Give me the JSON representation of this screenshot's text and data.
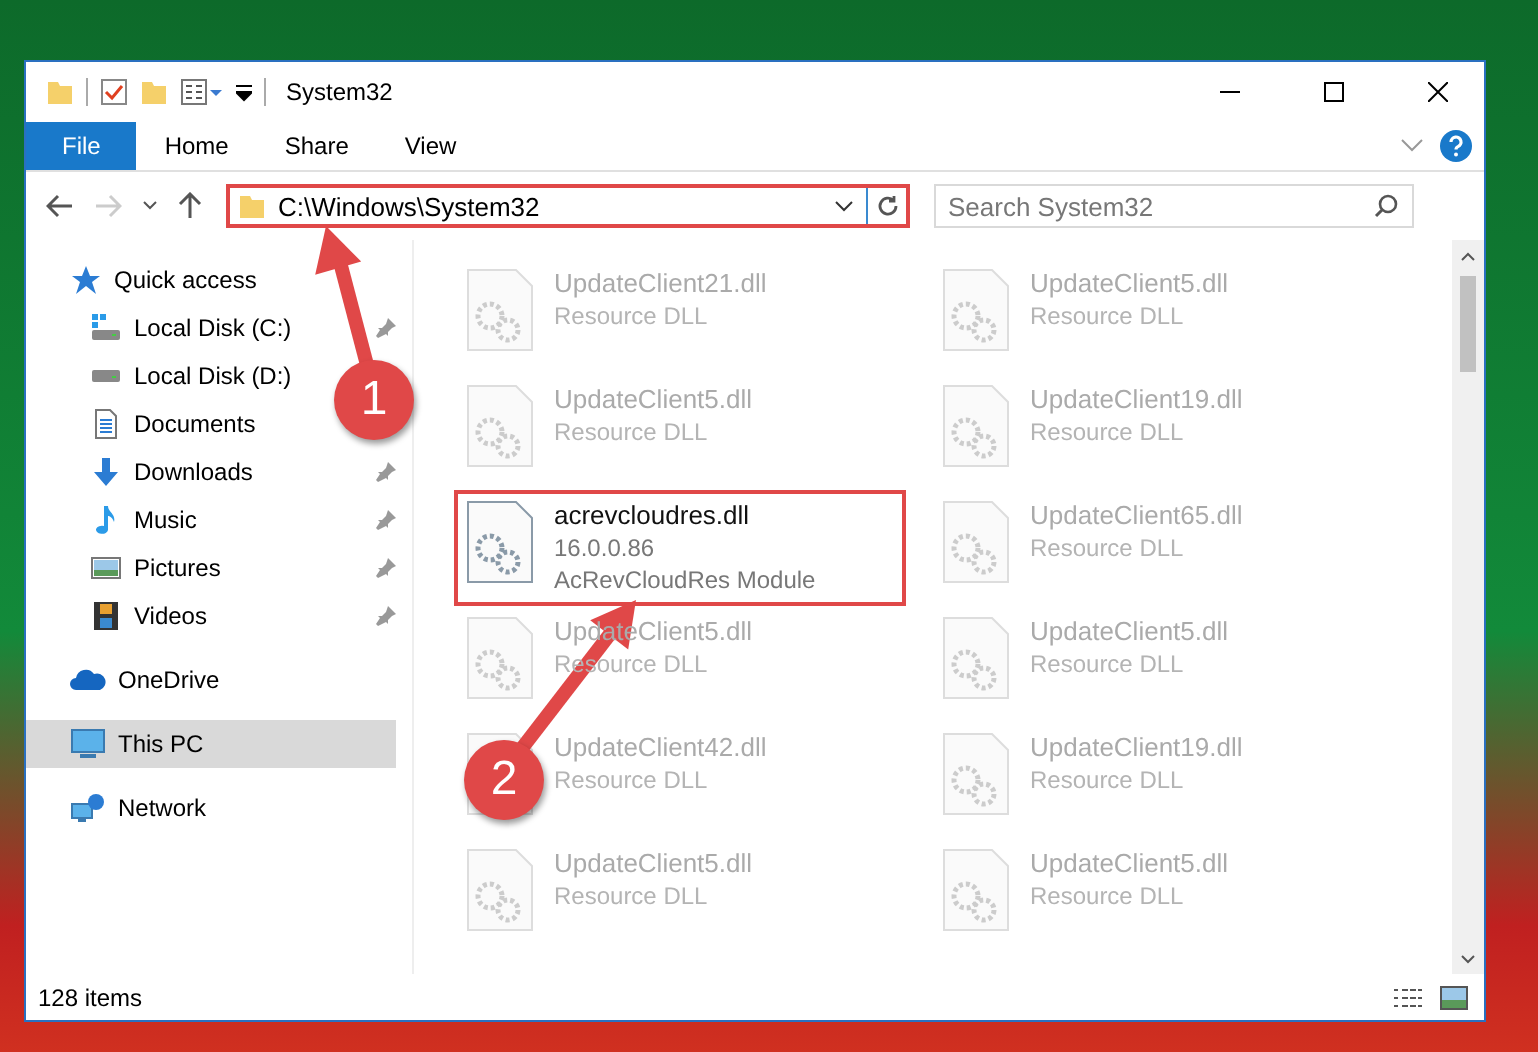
{
  "window": {
    "title": "System32"
  },
  "ribbon": {
    "tabs": [
      {
        "label": "File",
        "kind": "file",
        "selected": false
      },
      {
        "label": "Home",
        "kind": "tab",
        "selected": false
      },
      {
        "label": "Share",
        "kind": "tab",
        "selected": false
      },
      {
        "label": "View",
        "kind": "tab",
        "selected": false
      }
    ]
  },
  "address_bar": {
    "path": "C:\\Windows\\System32",
    "highlighted": true
  },
  "search": {
    "placeholder": "Search System32"
  },
  "sidebar": {
    "items": [
      {
        "label": "Quick access",
        "selected": false,
        "children": [
          {
            "label": "Local Disk (C:)",
            "pinned": true,
            "selected": false
          },
          {
            "label": "Local Disk (D:)",
            "pinned": false,
            "selected": false
          },
          {
            "label": "Documents",
            "pinned": false,
            "selected": false
          },
          {
            "label": "Downloads",
            "pinned": true,
            "selected": false
          },
          {
            "label": "Music",
            "pinned": true,
            "selected": false
          },
          {
            "label": "Pictures",
            "pinned": true,
            "selected": false
          },
          {
            "label": "Videos",
            "pinned": true,
            "selected": false
          }
        ]
      },
      {
        "label": "OneDrive",
        "selected": false
      },
      {
        "label": "This PC",
        "selected": true
      },
      {
        "label": "Network",
        "selected": false
      }
    ]
  },
  "files": [
    {
      "name": "UpdateClient21.dll",
      "lines": [
        "Resource DLL"
      ],
      "highlighted": false
    },
    {
      "name": "UpdateClient5.dll",
      "lines": [
        "Resource DLL"
      ],
      "highlighted": false
    },
    {
      "name": "UpdateClient5.dll",
      "lines": [
        "Resource DLL"
      ],
      "highlighted": false
    },
    {
      "name": "UpdateClient19.dll",
      "lines": [
        "Resource DLL"
      ],
      "highlighted": false
    },
    {
      "name": "acrevcloudres.dll",
      "lines": [
        "16.0.0.86",
        "AcRevCloudRes Module"
      ],
      "highlighted": true
    },
    {
      "name": "UpdateClient65.dll",
      "lines": [
        "Resource DLL"
      ],
      "highlighted": false
    },
    {
      "name": "UpdateClient5.dll",
      "lines": [
        "Resource DLL"
      ],
      "highlighted": false
    },
    {
      "name": "UpdateClient5.dll",
      "lines": [
        "Resource DLL"
      ],
      "highlighted": false
    },
    {
      "name": "UpdateClient42.dll",
      "lines": [
        "Resource DLL"
      ],
      "highlighted": false
    },
    {
      "name": "UpdateClient19.dll",
      "lines": [
        "Resource DLL"
      ],
      "highlighted": false
    },
    {
      "name": "UpdateClient5.dll",
      "lines": [
        "Resource DLL"
      ],
      "highlighted": false
    },
    {
      "name": "UpdateClient5.dll",
      "lines": [
        "Resource DLL"
      ],
      "highlighted": false
    }
  ],
  "status_bar": {
    "count": "128 items"
  },
  "annotations": [
    {
      "number": "1"
    },
    {
      "number": "2"
    }
  ]
}
